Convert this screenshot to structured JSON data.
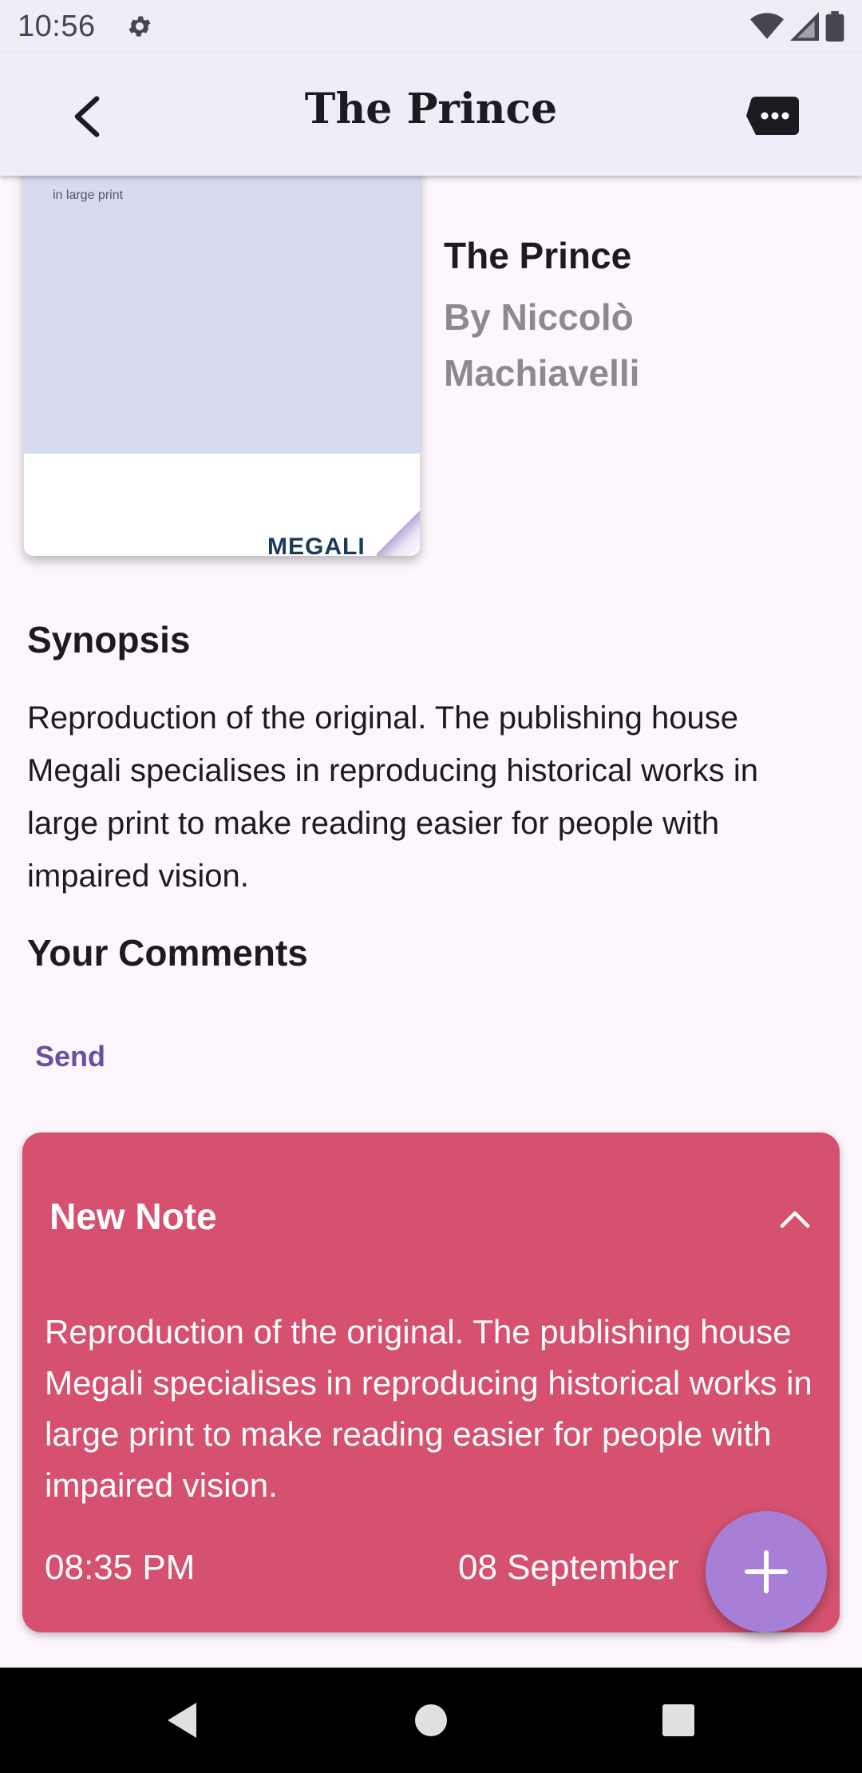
{
  "status_bar": {
    "time": "10:56",
    "icons": [
      "settings-gear-icon",
      "wifi-icon",
      "cellular-signal-icon",
      "battery-icon"
    ]
  },
  "app_bar": {
    "title": "The Prince",
    "back_icon": "back-arrow-icon",
    "action_icon": "chat-more-icon",
    "background": "#f1edf8"
  },
  "book": {
    "title": "The Prince",
    "author": "By Niccolò Machiavelli",
    "cover": {
      "print_text": "in large print",
      "publisher_logo": "MEGALI"
    }
  },
  "synopsis": {
    "heading": "Synopsis",
    "text": "Reproduction of the original. The publishing house Megali specialises in reproducing historical works in large print to make reading easier for people with impaired vision."
  },
  "comments": {
    "heading": "Your Comments",
    "send_label": "Send",
    "accent": "#6750a4"
  },
  "note": {
    "title": "New Note",
    "text": "Reproduction of the original. The publishing house Megali specialises in reproducing historical works in large print to make reading easier for people with impaired vision.",
    "time": "08:35 PM",
    "date": "08 September",
    "color": "#d5516f",
    "collapse_icon": "chevron-up-icon"
  },
  "fab": {
    "icon": "plus-icon",
    "color": "#a77fd7"
  },
  "nav_bar": {
    "buttons": [
      "nav-back-icon",
      "nav-home-icon",
      "nav-recents-icon"
    ]
  }
}
